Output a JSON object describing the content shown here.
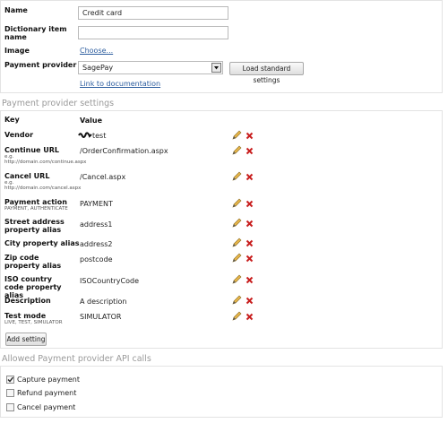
{
  "general": {
    "name_label": "Name",
    "name_value": "Credit card",
    "dict_label": "Dictionary item name",
    "dict_value": "",
    "image_label": "Image",
    "choose_link": "Choose...",
    "provider_label": "Payment provider",
    "provider_selected": "SagePay",
    "load_button": "Load standard settings",
    "doc_link": "Link to documentation"
  },
  "settings": {
    "title": "Payment provider settings",
    "key_header": "Key",
    "value_header": "Value",
    "rows": [
      {
        "key": "Vendor",
        "hint": "",
        "value": "test"
      },
      {
        "key": "Continue URL",
        "hint": "e.g.\nhttp://domain.com/continue.aspx",
        "value": "/OrderConfirmation.aspx"
      },
      {
        "key": "Cancel URL",
        "hint": "e.g.\nhttp://domain.com/cancel.aspx",
        "value": "/Cancel.aspx"
      },
      {
        "key": "Payment action",
        "hint": "PAYMENT, AUTHENTICATE",
        "value": "PAYMENT"
      },
      {
        "key": "Street address property alias",
        "hint": "",
        "value": "address1"
      },
      {
        "key": "City property alias",
        "hint": "",
        "value": "address2"
      },
      {
        "key": "Zip code property alias",
        "hint": "",
        "value": "postcode"
      },
      {
        "key": "ISO country code property alias",
        "hint": "",
        "value": "ISOCountryCode"
      },
      {
        "key": "Description",
        "hint": "",
        "value": "A description"
      },
      {
        "key": "Test mode",
        "hint": "LIVE, TEST, SIMULATOR",
        "value": "SIMULATOR"
      }
    ],
    "add_button": "Add setting"
  },
  "api_calls": {
    "title": "Allowed Payment provider API calls",
    "items": [
      {
        "label": "Capture payment",
        "checked": true
      },
      {
        "label": "Refund payment",
        "checked": false
      },
      {
        "label": "Cancel payment",
        "checked": false
      }
    ]
  },
  "colors": {
    "link": "#2b5c9e",
    "delete_icon": "#c81e1e",
    "pencil_icon": "#d9a43a"
  }
}
